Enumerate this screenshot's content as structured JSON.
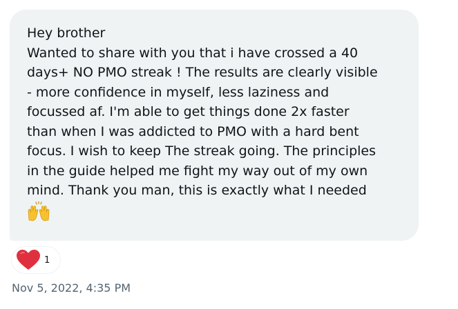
{
  "message": {
    "lines": [
      "Hey brother",
      "Wanted to share with you that i have crossed a 40",
      "days+ NO PMO streak ! The results are clearly visible",
      "- more confidence in myself, less laziness and",
      "focussed af. I'm able to get things done 2x faster",
      "than when I was addicted to PMO with a hard bent",
      "focus. I wish to keep The streak going. The principles",
      "in the guide helped me fight my way out of my own",
      "mind. Thank you man, this is exactly what I needed"
    ],
    "emoji": "raising-hands-emoji"
  },
  "reaction": {
    "icon": "heart-icon",
    "count": "1",
    "color": "#e0303f"
  },
  "timestamp": "Nov 5, 2022, 4:35 PM",
  "colors": {
    "bubble": "#eff3f4",
    "text": "#0f1419",
    "muted": "#536471"
  }
}
